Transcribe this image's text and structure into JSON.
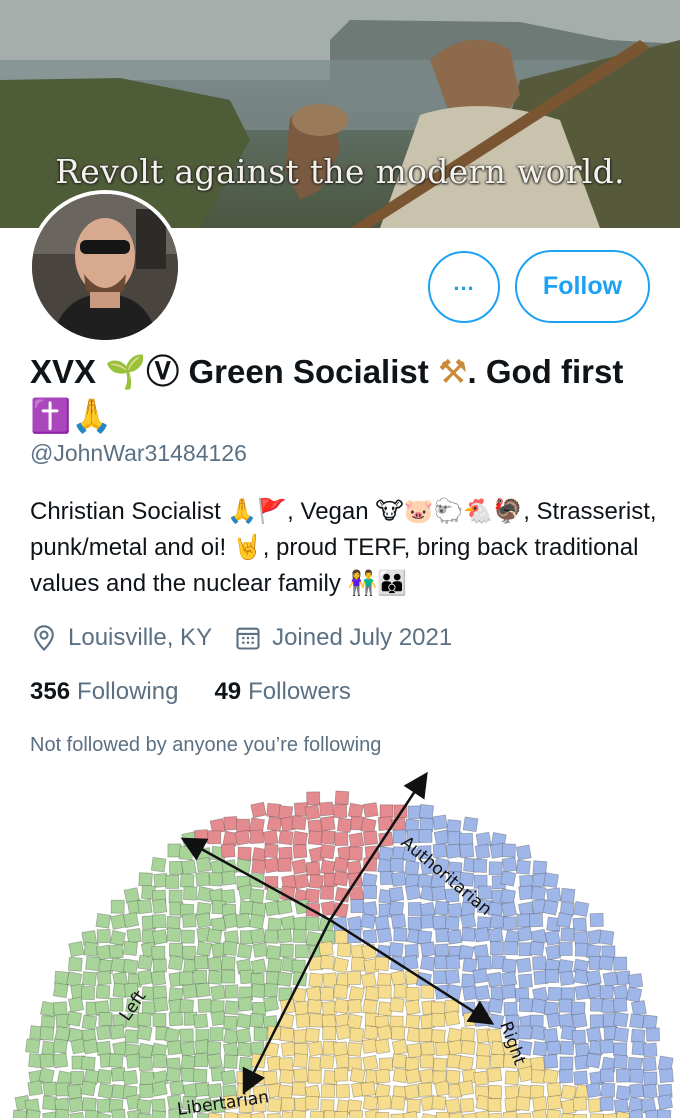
{
  "banner": {
    "caption": "Revolt against the modern world."
  },
  "profile": {
    "display_name_parts": [
      "XVX ",
      " Green Socialist ",
      ". God first "
    ],
    "emoji": {
      "seedling": "🌱",
      "vegan_mark": "Ⓥ",
      "hammer_pick": "⚒",
      "cross": "✝️",
      "pray": "🙏"
    },
    "handle": "@JohnWar31484126",
    "bio_parts": [
      "Christian Socialist ",
      "🙏🚩",
      ", Vegan ",
      "🐮🐷🐑🐔🦃",
      ", Strasserist, punk/metal and oi! ",
      "🤘",
      ", proud TERF, bring back traditional values and the nuclear family ",
      "👫👪"
    ],
    "location": "Louisville, KY",
    "joined": "Joined July 2021",
    "following_count": "356",
    "following_label": "Following",
    "followers_count": "49",
    "followers_label": "Followers",
    "not_followed_text": "Not followed by anyone you’re following"
  },
  "actions": {
    "more_label": "...",
    "follow_label": "Follow"
  },
  "icons": {
    "more": "more-icon",
    "location": "location-pin-icon",
    "calendar": "calendar-icon"
  },
  "colors": {
    "accent": "#1da1f2",
    "secondary_text": "#5b7083",
    "quadrant_red": "#e48b8f",
    "quadrant_blue": "#9fb6e8",
    "quadrant_green": "#a8d49a",
    "quadrant_yellow": "#f6dd8e"
  },
  "compass": {
    "left_label": "Left",
    "right_label": "Right",
    "top_label": "Authoritarian",
    "bottom_label": "Libertarian"
  }
}
